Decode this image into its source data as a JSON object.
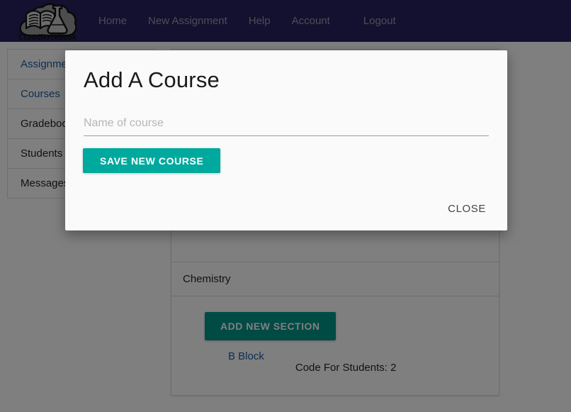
{
  "navbar": {
    "brand_text": "CloudNotebook",
    "brand_icon": "cloud-book-flask-logo",
    "background_color": "#26235e",
    "links": [
      {
        "label": "Home"
      },
      {
        "label": "New Assignment"
      },
      {
        "label": "Help"
      },
      {
        "label": "Account"
      },
      {
        "label": "Logout"
      }
    ]
  },
  "sidebar": {
    "items": [
      {
        "label": "Assignments",
        "is_link": true
      },
      {
        "label": "Courses",
        "is_link": true
      },
      {
        "label": "Gradebook",
        "is_link": false
      },
      {
        "label": "Students",
        "is_link": false
      },
      {
        "label": "Messages",
        "is_link": false
      }
    ]
  },
  "main": {
    "course_name": "Chemistry",
    "add_section_label": "ADD NEW SECTION",
    "section_name": "B Block",
    "section_code_text": "Code For Students: 2",
    "section_button_color": "#009688",
    "link_color": "#1a5ea8"
  },
  "modal": {
    "title": "Add A Course",
    "input_placeholder": "Name of course",
    "input_value": "",
    "save_label": "SAVE NEW COURSE",
    "close_label": "CLOSE",
    "save_button_color": "#00a99d"
  }
}
